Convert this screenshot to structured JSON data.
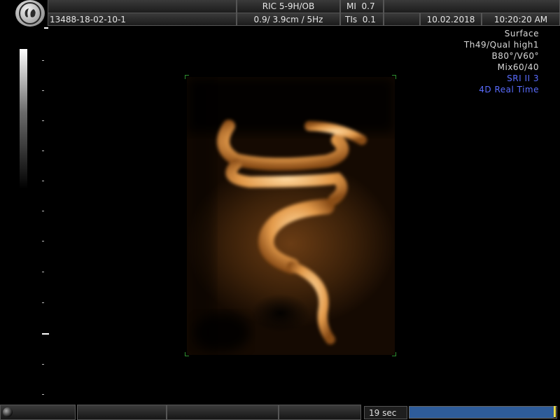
{
  "header": {
    "probe": "RIC 5-9H/OB",
    "mi_label": "MI",
    "mi_value": "0.7",
    "patient_id": "13488-18-02-10-1",
    "depth_freq": "0.9/ 3.9cm /  5Hz",
    "tis_label": "TIs",
    "tis_value": "0.1",
    "date": "10.02.2018",
    "time": "10:20:20 AM"
  },
  "settings": {
    "render_mode": "Surface",
    "quality": "Th49/Qual high1",
    "angles": "B80°/V60°",
    "mix": "Mix60/40",
    "sri": "SRI II 3",
    "mode": "4D Real Time"
  },
  "colors": {
    "accent_blue": "#5a6cff",
    "render_orange": "#e8a050",
    "progress_blue": "#2e5c9a"
  },
  "footer": {
    "timer": "19 sec",
    "progress": 0.98
  },
  "icons": {
    "logo": "ge-logo-icon",
    "knob": "trackball-icon"
  }
}
